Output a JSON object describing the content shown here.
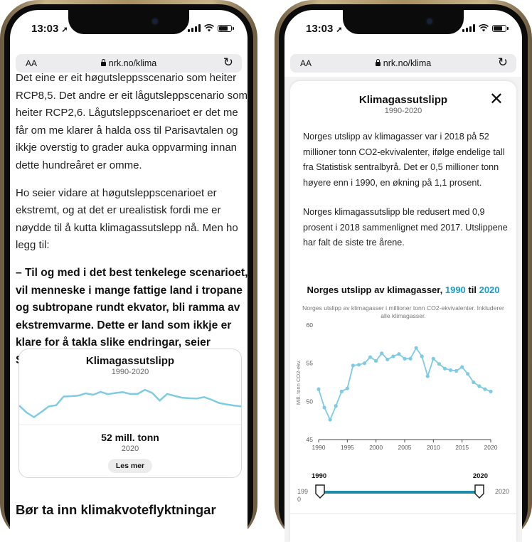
{
  "left_phone": {
    "time": "13:03",
    "url_bar": {
      "aa": "AA",
      "url": "nrk.no/klima"
    },
    "paragraphs": [
      "Det eine er eit høgutsleppsscenario som heiter RCP8,5. Det andre er eit lågutsleppscenario som heiter RCP2,6. Lågutsleppscenarioet er det me får om me klarer å halda oss til Parisavtalen og ikkje overstig to grader auka oppvarming innan dette hundreåret er omme.",
      "Ho seier vidare at høgutsleppscenarioet er ekstremt, og at det er urealistisk fordi me er nøydde til å kutta klimagassutslepp nå. Men ho legg til:"
    ],
    "quote": "– Til og med i det best tenkelege scenarioet, vil menneske i mange fattige land i tropane og subtropane rundt ekvator, bli ramma av ekstremvarme. Dette er land som ikkje er klare for å takla slike endringar, seier Sillmann.",
    "card": {
      "title": "Klimagassutslipp",
      "subtitle": "1990-2020",
      "value": "52 mill. tonn",
      "year": "2020",
      "button": "Les mer"
    },
    "subheading": "Bør ta inn klimakvoteflyktningar"
  },
  "right_phone": {
    "time": "13:03",
    "url_bar": {
      "aa": "AA",
      "url": "nrk.no/klima"
    },
    "modal": {
      "title": "Klimagassutslipp",
      "subtitle": "1990-2020",
      "paragraph1": "Norges utslipp av klimagasser var i 2018 på 52 millioner tonn CO2-ekvivalenter, ifølge endelige tall fra Statistisk sentralbyrå. Det er 0,5 millioner tonn høyere enn i 1990, en økning på 1,1 prosent.",
      "paragraph2": "Norges klimagassutslipp ble redusert med 0,9 prosent i 2018 sammenlignet med 2017. Utslippene har falt de siste tre årene.",
      "chart_title_prefix": "Norges utslipp av klimagasser,",
      "chart_title_from": "1990",
      "chart_title_mid": "til",
      "chart_title_to": "2020",
      "chart_description": "Norges utslipp av klimagasser i millioner tonn CO2-ekvivalenter. Inkluderer alle klimagasser.",
      "slider": {
        "start_label": "1990",
        "end_label": "2020",
        "left_value": "199\n0",
        "right_value": "2020"
      }
    }
  },
  "colors": {
    "accent": "#1a9cc8",
    "line": "#7ecbe3",
    "slider": "#1f8ba6"
  },
  "icons": {
    "close": "close-icon",
    "reload": "reload-icon",
    "lock": "lock-icon",
    "location": "location-arrow-icon"
  },
  "chart_data": {
    "type": "line",
    "title": "Norges utslipp av klimagasser, 1990 til 2020",
    "subtitle": "Norges utslipp av klimagasser i millioner tonn CO2-ekvivalenter. Inkluderer alle klimagasser.",
    "xlabel": "",
    "ylabel": "Mill. tonn CO2-ekv.",
    "x": [
      1990,
      1991,
      1992,
      1993,
      1994,
      1995,
      1996,
      1997,
      1998,
      1999,
      2000,
      2001,
      2002,
      2003,
      2004,
      2005,
      2006,
      2007,
      2008,
      2009,
      2010,
      2011,
      2012,
      2013,
      2014,
      2015,
      2016,
      2017,
      2018,
      2019,
      2020
    ],
    "y": [
      51.6,
      49.2,
      47.6,
      49.4,
      51.3,
      51.7,
      54.7,
      54.8,
      55.0,
      55.8,
      55.3,
      56.3,
      55.5,
      55.9,
      56.2,
      55.6,
      55.6,
      57.0,
      55.9,
      53.3,
      55.6,
      54.9,
      54.3,
      54.1,
      54.0,
      54.5,
      53.6,
      52.5,
      52.0,
      51.6,
      51.3
    ],
    "xticks": [
      1990,
      1995,
      2000,
      2005,
      2010,
      2015,
      2020
    ],
    "yticks": [
      45,
      50,
      55,
      60
    ],
    "xlim": [
      1990,
      2020
    ],
    "ylim": [
      45,
      60
    ],
    "color": "#7ecbe3"
  }
}
